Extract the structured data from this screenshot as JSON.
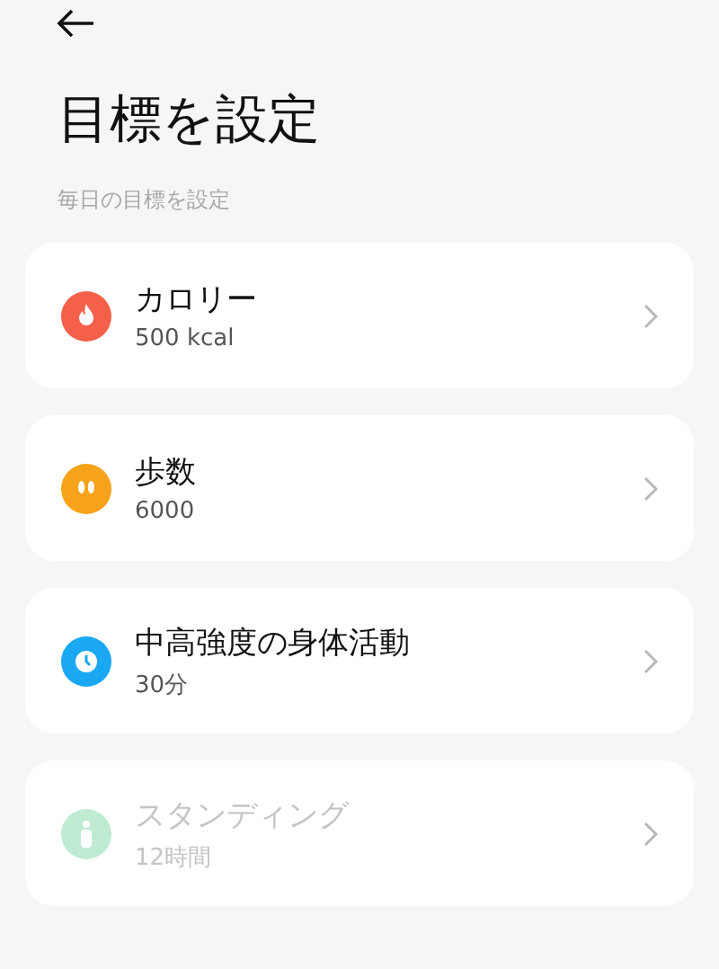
{
  "title": "目標を設定",
  "subtitle": "毎日の目標を設定",
  "goals": [
    {
      "kind": "flame",
      "color": "#f5604a",
      "name": "カロリー",
      "value": "500 kcal",
      "disabled": false
    },
    {
      "kind": "steps",
      "color": "#f7a21b",
      "name": "歩数",
      "value": "6000",
      "disabled": false
    },
    {
      "kind": "clock",
      "color": "#1aa8f2",
      "name": "中高強度の身体活動",
      "value": "30分",
      "disabled": false
    },
    {
      "kind": "standing",
      "color": "#c0ebd3",
      "name": "スタンディング",
      "value": "12時間",
      "disabled": true
    }
  ]
}
